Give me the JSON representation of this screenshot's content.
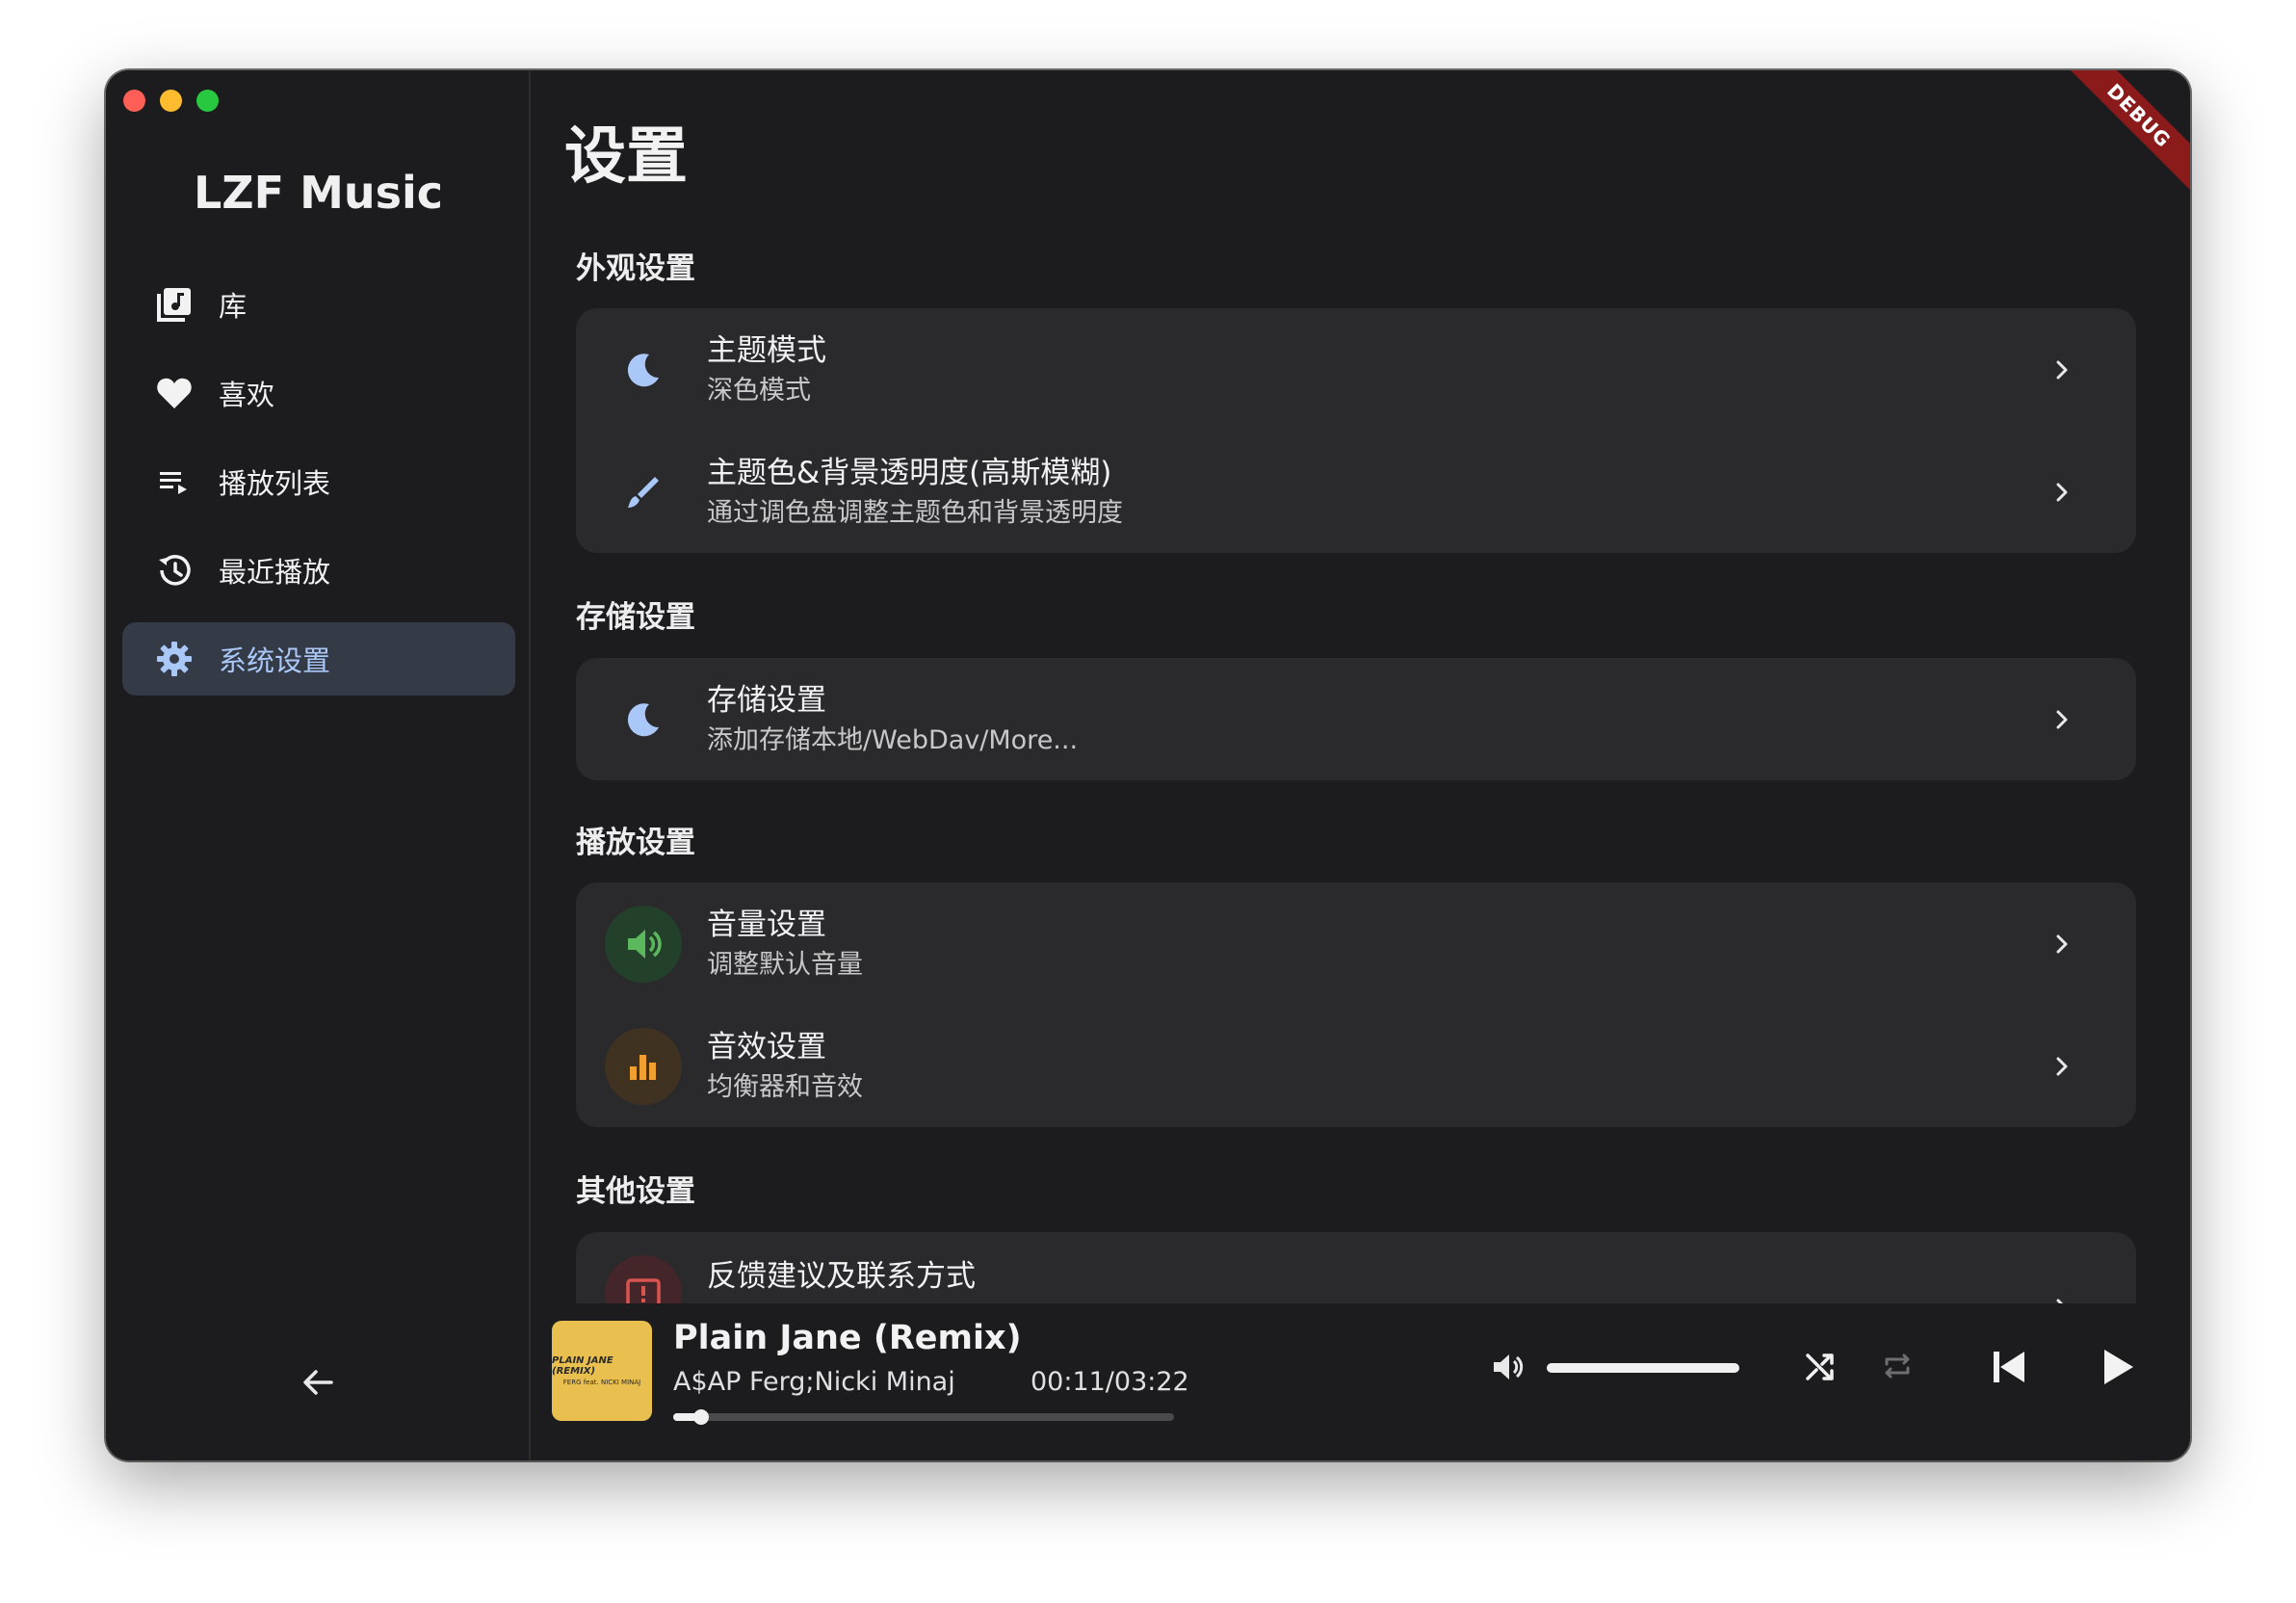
{
  "app": {
    "title": "LZF Music",
    "debug_label": "DEBUG"
  },
  "sidebar": {
    "items": [
      {
        "label": "库",
        "icon": "library-music-icon",
        "active": false
      },
      {
        "label": "喜欢",
        "icon": "heart-icon",
        "active": false
      },
      {
        "label": "播放列表",
        "icon": "playlist-icon",
        "active": false
      },
      {
        "label": "最近播放",
        "icon": "history-icon",
        "active": false
      },
      {
        "label": "系统设置",
        "icon": "gear-icon",
        "active": true
      }
    ],
    "back_icon": "arrow-left-icon"
  },
  "main": {
    "page_title": "设置",
    "sections": [
      {
        "title": "外观设置",
        "rows": [
          {
            "title": "主题模式",
            "subtitle": "深色模式",
            "icon": "moon-icon"
          },
          {
            "title": "主题色&背景透明度(高斯模糊)",
            "subtitle": "通过调色盘调整主题色和背景透明度",
            "icon": "brush-icon"
          }
        ]
      },
      {
        "title": "存储设置",
        "rows": [
          {
            "title": "存储设置",
            "subtitle": "添加存储本地/WebDav/More...",
            "icon": "moon-icon"
          }
        ]
      },
      {
        "title": "播放设置",
        "rows": [
          {
            "title": "音量设置",
            "subtitle": "调整默认音量",
            "icon": "volume-icon"
          },
          {
            "title": "音效设置",
            "subtitle": "均衡器和音效",
            "icon": "equalizer-icon"
          }
        ]
      },
      {
        "title": "其他设置",
        "rows": [
          {
            "title": "反馈建议及联系方式",
            "subtitle": "",
            "icon": "feedback-icon"
          }
        ]
      }
    ]
  },
  "player": {
    "song_title": "Plain Jane (Remix)",
    "artist": "A$AP Ferg;Nicki Minaj",
    "time": "00:11/03:22",
    "progress": 0.056,
    "volume": 1.0,
    "album_art_text": "PLAIN JANE (REMIX)",
    "album_art_subtext": "FERG feat. NICKI MINAJ"
  },
  "colors": {
    "accent": "#a9c7f7",
    "volume_green": "#5cb85c",
    "equalizer_orange": "#f0a030",
    "feedback_red": "#d9534f"
  }
}
